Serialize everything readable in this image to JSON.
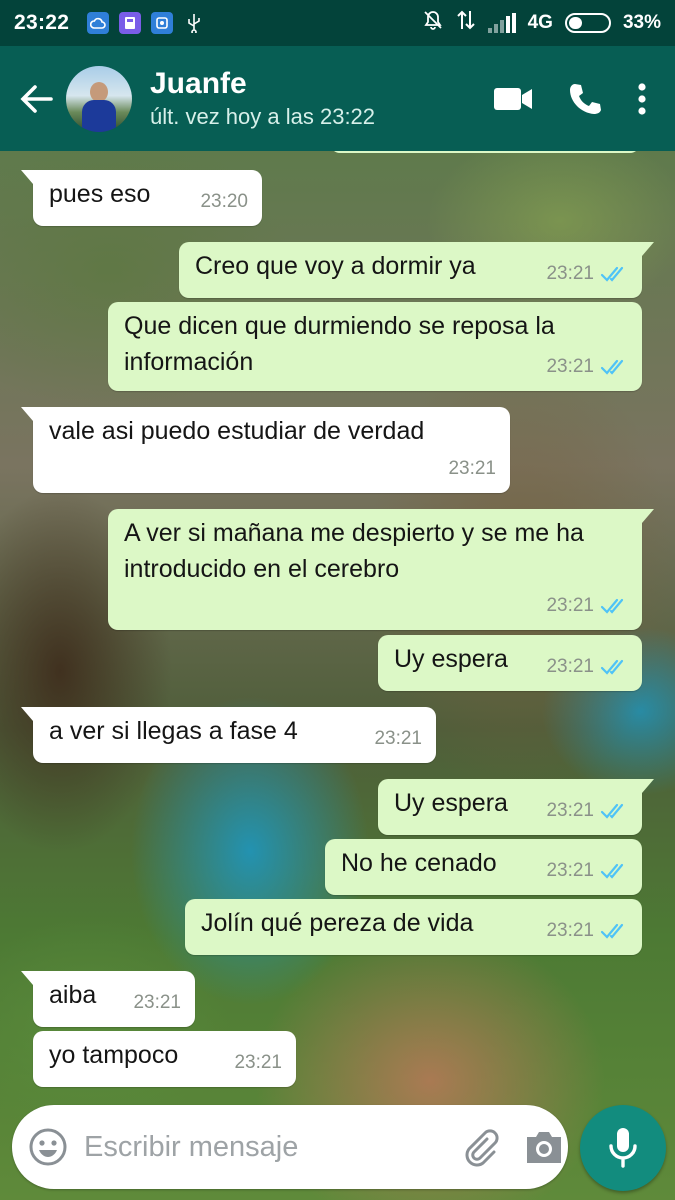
{
  "status_bar": {
    "time": "23:22",
    "network": "4G",
    "battery": "33%",
    "battery_level": 0.33,
    "notification_icons": [
      "cloud-icon",
      "gallery-icon",
      "vpn-icon",
      "usb-icon"
    ],
    "status_icons": [
      "mute-icon",
      "data-transfer-icon",
      "signal-icon",
      "battery-icon"
    ]
  },
  "header": {
    "contact_name": "Juanfe",
    "last_seen": "últ. vez hoy a las 23:22",
    "actions": [
      "video-call-icon",
      "phone-call-icon",
      "more-options-icon"
    ]
  },
  "messages": [
    {
      "dir": "in",
      "text": "pues eso",
      "time": "23:20"
    },
    {
      "dir": "out",
      "text": "Creo que voy a dormir ya",
      "time": "23:21",
      "read": true
    },
    {
      "dir": "out",
      "text": "Que dicen que durmiendo se reposa la información",
      "time": "23:21",
      "read": true
    },
    {
      "dir": "in",
      "text": "vale asi puedo estudiar de verdad",
      "time": "23:21"
    },
    {
      "dir": "out",
      "text": "A ver si mañana me despierto y se me ha introducido en el cerebro",
      "time": "23:21",
      "read": true
    },
    {
      "dir": "out",
      "text": "Uy espera",
      "time": "23:21",
      "read": true
    },
    {
      "dir": "in",
      "text": "a ver si llegas a fase 4",
      "time": "23:21"
    },
    {
      "dir": "out",
      "text": "Uy espera",
      "time": "23:21",
      "read": true
    },
    {
      "dir": "out",
      "text": "No he cenado",
      "time": "23:21",
      "read": true
    },
    {
      "dir": "out",
      "text": "Jolín qué pereza de vida",
      "time": "23:21",
      "read": true
    },
    {
      "dir": "in",
      "text": "aiba",
      "time": "23:21"
    },
    {
      "dir": "in",
      "text": "yo tampoco",
      "time": "23:21"
    }
  ],
  "composer": {
    "placeholder": "Escribir mensaje",
    "value": ""
  },
  "colors": {
    "status_bar": "#03433a",
    "app_bar": "#075e54",
    "incoming_bubble": "#ffffff",
    "outgoing_bubble": "#dcf8c6",
    "read_ticks": "#4fc3f7",
    "mic_button": "#128c7e"
  }
}
